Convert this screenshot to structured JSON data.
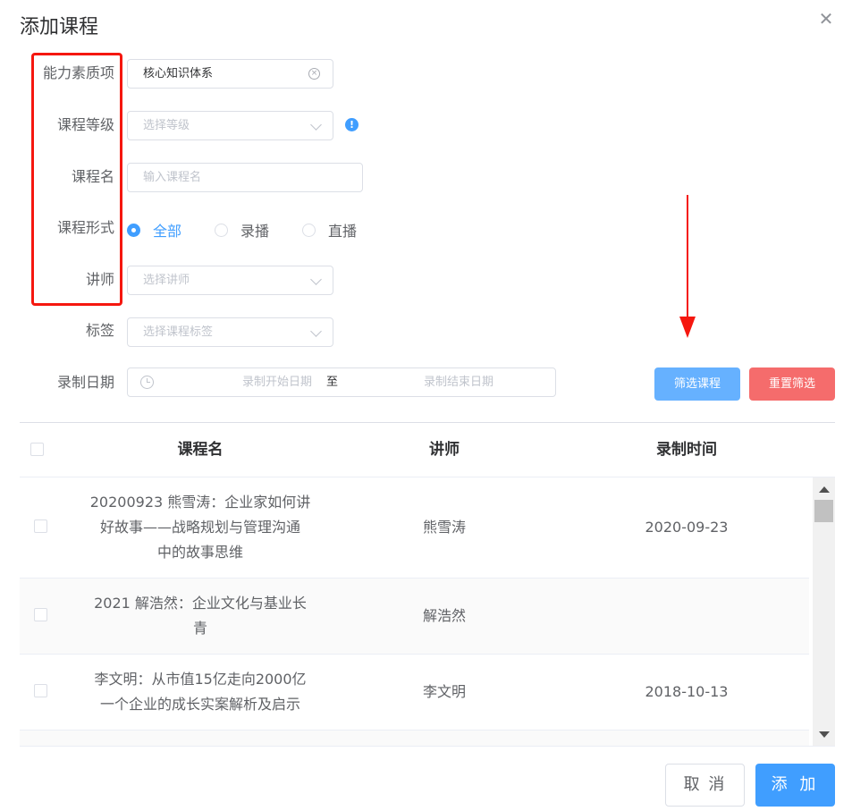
{
  "dialog": {
    "title": "添加课程",
    "close_icon": "close-icon"
  },
  "form": {
    "ability": {
      "label": "能力素质项",
      "value": "核心知识体系"
    },
    "level": {
      "label": "课程等级",
      "placeholder": "选择等级"
    },
    "course_name": {
      "label": "课程名",
      "placeholder": "输入课程名"
    },
    "format": {
      "label": "课程形式",
      "options": [
        "全部",
        "录播",
        "直播"
      ],
      "selected": "全部"
    },
    "teacher": {
      "label": "讲师",
      "placeholder": "选择讲师"
    },
    "tag": {
      "label": "标签",
      "placeholder": "选择课程标签"
    },
    "record_date": {
      "label": "录制日期",
      "start_placeholder": "录制开始日期",
      "separator": "至",
      "end_placeholder": "录制结束日期"
    }
  },
  "actions": {
    "filter": "筛选课程",
    "reset": "重置筛选"
  },
  "table": {
    "headers": [
      "课程名",
      "讲师",
      "录制时间"
    ],
    "rows": [
      {
        "name_lines": [
          "20200923 熊雪涛：企业家如何讲",
          "好故事——战略规划与管理沟通",
          "中的故事思维"
        ],
        "teacher": "熊雪涛",
        "date": "2020-09-23"
      },
      {
        "name_lines": [
          "2021 解浩然：企业文化与基业长",
          "青"
        ],
        "teacher": "解浩然",
        "date": ""
      },
      {
        "name_lines": [
          "李文明：从市值15亿走向2000亿",
          "一个企业的成长实案解析及启示"
        ],
        "teacher": "李文明",
        "date": "2018-10-13"
      }
    ]
  },
  "footer": {
    "cancel": "取 消",
    "add": "添 加"
  },
  "colors": {
    "primary": "#409eff",
    "annotation_red": "#f5170f",
    "danger": "#f56c6c"
  }
}
